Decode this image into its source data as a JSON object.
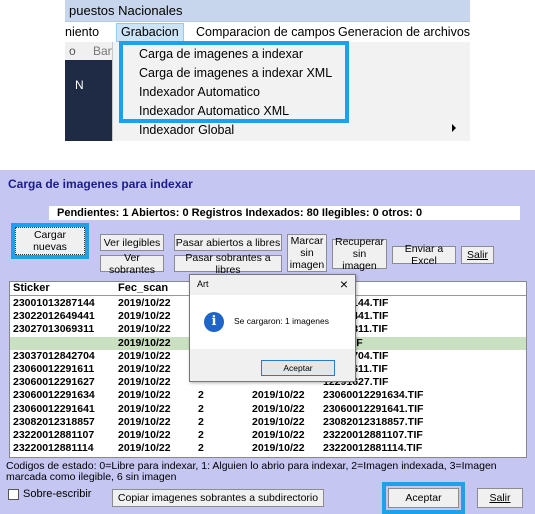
{
  "menu": {
    "window_title": "puestos Nacionales",
    "menubar": [
      "niento",
      "Grabacion",
      "Comparacion de campos",
      "Generacion de archivos"
    ],
    "toolbar_fragments": [
      "o",
      "Ban"
    ],
    "side_text": "N",
    "dropdown_items": [
      "Carga de imagenes a indexar",
      "Carga de imagenes a indexar XML",
      "Indexador Automatico",
      "Indexador Automatico XML",
      "Indexador Global"
    ]
  },
  "dialog": {
    "title": "Carga de imagenes para indexar",
    "status_text": "Pendientes: 1 Abiertos: 0 Registros Indexados: 80 Ilegibles: 0 otros: 0",
    "buttons": {
      "cargar_nuevas": "Cargar nuevas",
      "ver_ilegibles": "Ver ilegibles",
      "ver_sobrantes": "Ver sobrantes",
      "pasar_abiertos": "Pasar abiertos a libres",
      "pasar_sobrantes": "Pasar sobrantes a libres",
      "marcar_sin_imagen": "Marcar sin imagen",
      "recuperar_sin_imagen": "Recuperar sin imagen",
      "enviar_excel": "Enviar a Excel",
      "salir_top": "Salir",
      "copiar": "Copiar imagenes sobrantes a subdirectorio",
      "aceptar": "Aceptar",
      "salir_bottom": "Salir"
    },
    "columns": [
      "Sticker",
      "Fec_scan",
      "",
      "",
      "n"
    ],
    "rows": [
      [
        "23001013287144",
        "2019/10/22",
        "",
        "",
        "13287144.TIF"
      ],
      [
        "23022012649441",
        "2019/10/22",
        "",
        "",
        "12649441.TIF"
      ],
      [
        "23027013069311",
        "2019/10/22",
        "",
        "",
        "13069311.TIF"
      ],
      [
        "",
        "2019/10/22",
        "",
        "",
        "KKY.TIF"
      ],
      [
        "23037012842704",
        "2019/10/22",
        "",
        "",
        "12842704.TIF"
      ],
      [
        "23060012291611",
        "2019/10/22",
        "",
        "",
        "12291611.TIF"
      ],
      [
        "23060012291627",
        "2019/10/22",
        "",
        "",
        "12291627.TIF"
      ],
      [
        "23060012291634",
        "2019/10/22",
        "2",
        "2019/10/22",
        "23060012291634.TIF"
      ],
      [
        "23060012291641",
        "2019/10/22",
        "2",
        "2019/10/22",
        "23060012291641.TIF"
      ],
      [
        "23082012318857",
        "2019/10/22",
        "2",
        "2019/10/22",
        "23082012318857.TIF"
      ],
      [
        "23220012881107",
        "2019/10/22",
        "2",
        "2019/10/22",
        "23220012881107.TIF"
      ],
      [
        "23220012881114",
        "2019/10/22",
        "2",
        "2019/10/22",
        "23220012881114.TIF"
      ]
    ],
    "legend_text": "Codigos de estado: 0=Libre para indexar, 1: Alguien lo abrio para indexar, 2=Imagen indexada, 3=Imagen marcada como ilegible, 6 sin imagen",
    "checkbox_label": "Sobre-escribir",
    "msgbox": {
      "title": "Art",
      "close": "×",
      "text": "Se cargaron: 1 imagenes",
      "button": "Aceptar",
      "icon_glyph": "i"
    },
    "colors": {
      "background": "#c6c6f3",
      "title_text": "#1c1c8c",
      "highlight": "#1ea1e8",
      "selected_row": "#c9e1c1"
    }
  }
}
